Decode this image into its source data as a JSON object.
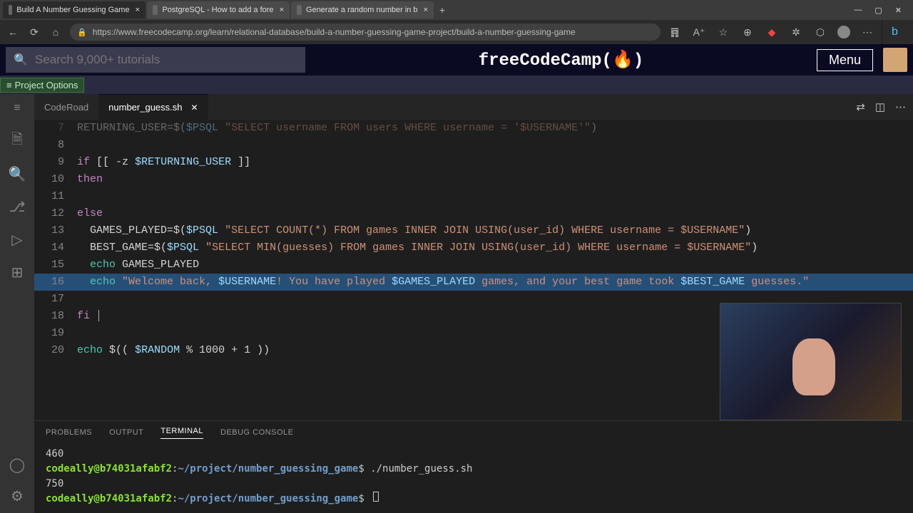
{
  "browser": {
    "tabs": [
      {
        "title": "Build A Number Guessing Game",
        "active": true
      },
      {
        "title": "PostgreSQL - How to add a fore",
        "active": false
      },
      {
        "title": "Generate a random number in b",
        "active": false
      }
    ],
    "new_tab": "+",
    "url": "https://www.freecodecamp.org/learn/relational-database/build-a-number-guessing-game-project/build-a-number-guessing-game",
    "win_min": "—",
    "win_max": "▢",
    "win_close": "✕"
  },
  "fcc": {
    "search_placeholder": "Search 9,000+ tutorials",
    "logo": "freeCodeCamp(🔥)",
    "menu": "Menu"
  },
  "project_options": "Project Options",
  "editor_tabs": {
    "coderoad": "CodeRoad",
    "file": "number_guess.sh",
    "close": "✕"
  },
  "code_lines": [
    {
      "n": 7,
      "text": "RETURNING_USER=$($PSQL \"SELECT username FROM users WHERE username = '$USERNAME'\")"
    },
    {
      "n": 8,
      "text": ""
    },
    {
      "n": 9,
      "text": "if [[ -z $RETURNING_USER ]]"
    },
    {
      "n": 10,
      "text": "then"
    },
    {
      "n": 11,
      "text": ""
    },
    {
      "n": 12,
      "text": "else"
    },
    {
      "n": 13,
      "text": "  GAMES_PLAYED=$($PSQL \"SELECT COUNT(*) FROM games INNER JOIN USING(user_id) WHERE username = $USERNAME\")"
    },
    {
      "n": 14,
      "text": "  BEST_GAME=$($PSQL \"SELECT MIN(guesses) FROM games INNER JOIN USING(user_id) WHERE username = $USERNAME\")"
    },
    {
      "n": 15,
      "text": "  echo GAMES_PLAYED"
    },
    {
      "n": 16,
      "text": "  echo \"Welcome back, $USERNAME! You have played $GAMES_PLAYED games, and your best game took $BEST_GAME guesses.\""
    },
    {
      "n": 17,
      "text": ""
    },
    {
      "n": 18,
      "text": "fi"
    },
    {
      "n": 19,
      "text": ""
    },
    {
      "n": 20,
      "text": "echo $(( $RANDOM % 1000 + 1 ))"
    }
  ],
  "panel": {
    "tabs": {
      "problems": "PROBLEMS",
      "output": "OUTPUT",
      "terminal": "TERMINAL",
      "debug": "DEBUG CONSOLE"
    },
    "lines": [
      "460",
      {
        "user": "codeally@b74031afabf2",
        "path": "~/project/number_guessing_game",
        "cmd": " ./number_guess.sh"
      },
      "750",
      {
        "user": "codeally@b74031afabf2",
        "path": "~/project/number_guessing_game",
        "cmd": " "
      }
    ]
  }
}
